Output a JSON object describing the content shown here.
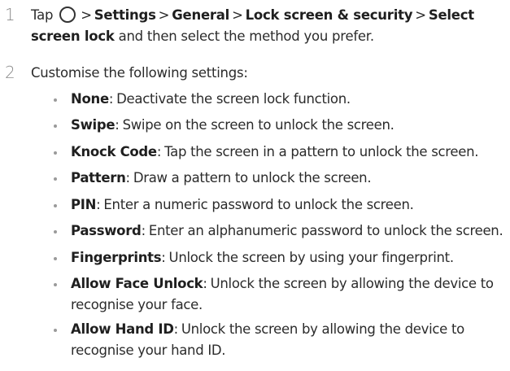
{
  "steps": [
    {
      "number": "1",
      "parts": {
        "tap": "Tap",
        "sep": ">",
        "settings": "Settings",
        "general": "General",
        "lock_screen": "Lock screen & security",
        "select_screen_lock": "Select screen lock",
        "rest": "and then select the method you prefer."
      },
      "icon": "home-circle-icon"
    },
    {
      "number": "2",
      "text": "Customise the following settings:"
    }
  ],
  "options": [
    {
      "title": "None",
      "desc": "Deactivate the screen lock function."
    },
    {
      "title": "Swipe",
      "desc": "Swipe on the screen to unlock the screen."
    },
    {
      "title": "Knock Code",
      "desc": "Tap the screen in a pattern to unlock the screen."
    },
    {
      "title": "Pattern",
      "desc": "Draw a pattern to unlock the screen."
    },
    {
      "title": "PIN",
      "desc": "Enter a numeric password to unlock the screen."
    },
    {
      "title": "Password",
      "desc": "Enter an alphanumeric password to unlock the screen."
    },
    {
      "title": "Fingerprints",
      "desc": "Unlock the screen by using your fingerprint."
    },
    {
      "title": "Allow Face Unlock",
      "desc": "Unlock the screen by allowing the device to recognise your face."
    },
    {
      "title": "Allow Hand ID",
      "desc": "Unlock the screen by allowing the device to recognise your hand ID."
    }
  ],
  "colors": {
    "text": "#2b2b2b",
    "step_number": "#8a8a8a",
    "bullet": "#9a9a9a"
  }
}
